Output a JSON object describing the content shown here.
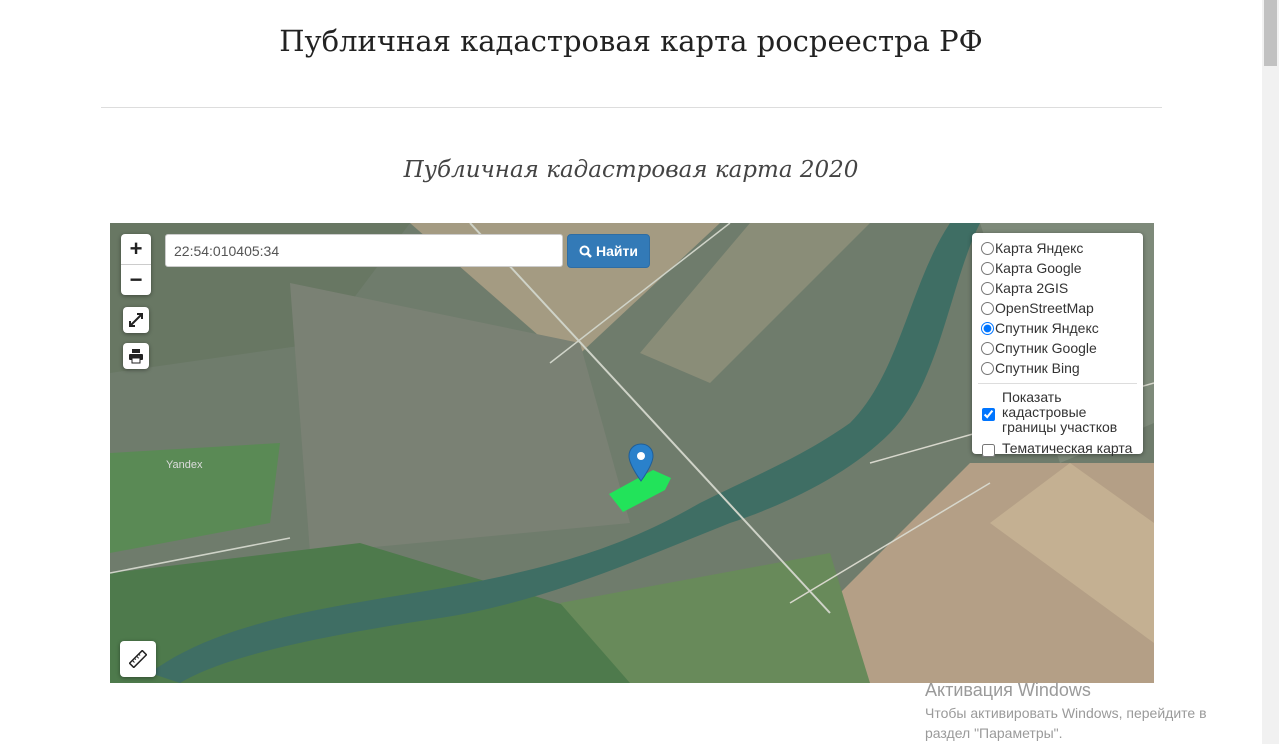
{
  "header": {
    "title": "Публичная кадастровая карта росреестра РФ",
    "subtitle": "Публичная кадастровая карта 2020"
  },
  "map": {
    "zoom_in": "+",
    "zoom_out": "−",
    "search": {
      "value": "22:54:010405:34",
      "button": "Найти"
    },
    "watermark": "Yandex",
    "layers": [
      {
        "label": "Карта Яндекс",
        "checked": false
      },
      {
        "label": "Карта Google",
        "checked": false
      },
      {
        "label": "Карта 2GIS",
        "checked": false
      },
      {
        "label": "OpenStreetMap",
        "checked": false
      },
      {
        "label": "Спутник Яндекс",
        "checked": true
      },
      {
        "label": "Спутник Google",
        "checked": false
      },
      {
        "label": "Спутник Bing",
        "checked": false
      }
    ],
    "options": [
      {
        "label": "Показать кадастровые границы участков",
        "checked": true
      },
      {
        "label": "Тематическая карта",
        "checked": false
      }
    ],
    "colors": {
      "parcel": "#22e35a",
      "marker": "#2a81cb",
      "accent": "#337ab7"
    }
  },
  "windows": {
    "title": "Активация Windows",
    "line1": "Чтобы активировать Windows, перейдите в",
    "line2": "раздел \"Параметры\"."
  }
}
